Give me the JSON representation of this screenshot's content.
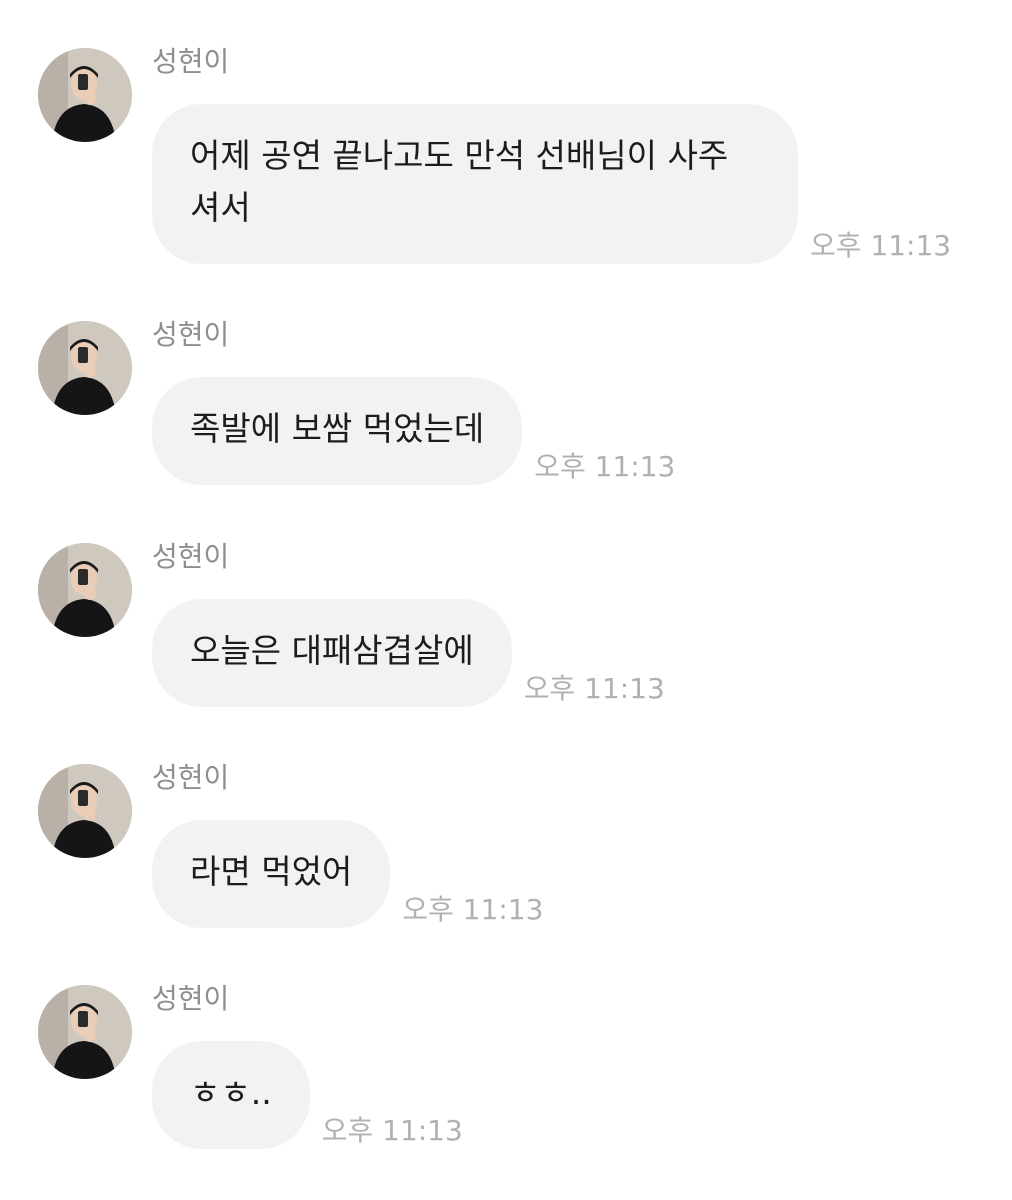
{
  "messages": [
    {
      "sender": "성현이",
      "text": "어제 공연 끝나고도 만석 선배님이 사주\n셔서",
      "time": "오후 11:13"
    },
    {
      "sender": "성현이",
      "text": "족발에 보쌈 먹었는데",
      "time": "오후 11:13"
    },
    {
      "sender": "성현이",
      "text": "오늘은 대패삼겹살에",
      "time": "오후 11:13"
    },
    {
      "sender": "성현이",
      "text": "라면 먹었어",
      "time": "오후 11:13"
    },
    {
      "sender": "성현이",
      "text": "ㅎㅎ..",
      "time": "오후 11:13"
    }
  ],
  "colors": {
    "bubble": "#f2f2f5",
    "sender_text": "#8e8e93",
    "time_text": "#b0b0b5",
    "message_text": "#1c1c1e"
  },
  "icons": {
    "avatar": "profile-photo"
  }
}
